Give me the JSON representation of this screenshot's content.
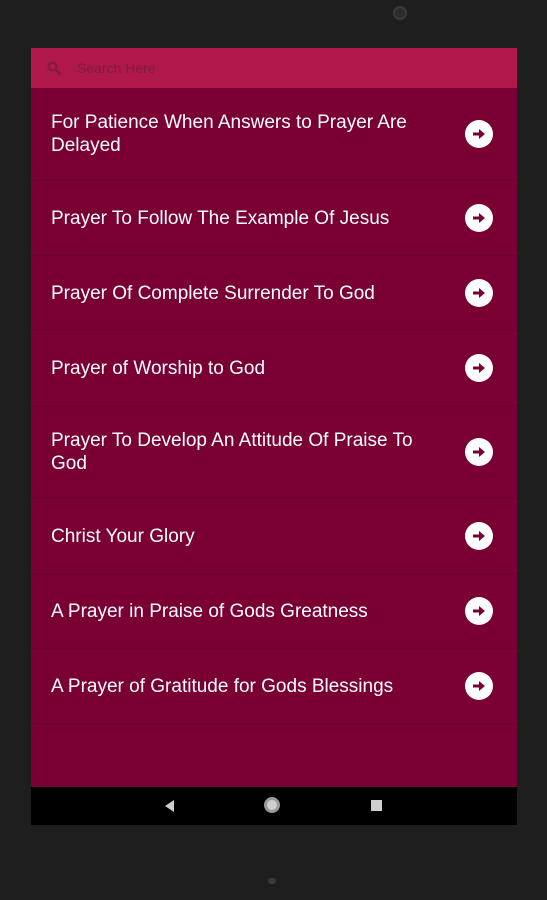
{
  "search": {
    "placeholder": "Search Here"
  },
  "list": {
    "items": [
      {
        "label": "For Patience When Answers to Prayer Are Delayed",
        "icon": "arrow-right-circle-icon"
      },
      {
        "label": "Prayer To Follow The Example Of Jesus",
        "icon": "arrow-right-circle-icon"
      },
      {
        "label": "Prayer Of Complete Surrender To God",
        "icon": "arrow-right-circle-icon"
      },
      {
        "label": "Prayer of Worship to God",
        "icon": "arrow-right-circle-icon"
      },
      {
        "label": "Prayer To Develop An Attitude Of Praise To God",
        "icon": "arrow-right-circle-icon"
      },
      {
        "label": "Christ Your Glory",
        "icon": "arrow-right-circle-icon"
      },
      {
        "label": "A Prayer in Praise of Gods Greatness",
        "icon": "arrow-right-circle-icon"
      },
      {
        "label": "A Prayer of Gratitude for Gods Blessings",
        "icon": "arrow-right-circle-icon"
      }
    ]
  },
  "navbar": {
    "icons": [
      "back-icon",
      "home-icon",
      "recent-apps-icon"
    ]
  },
  "colors": {
    "background": "#7a0033",
    "search_bar": "#b0184c",
    "text": "#ffffff"
  }
}
